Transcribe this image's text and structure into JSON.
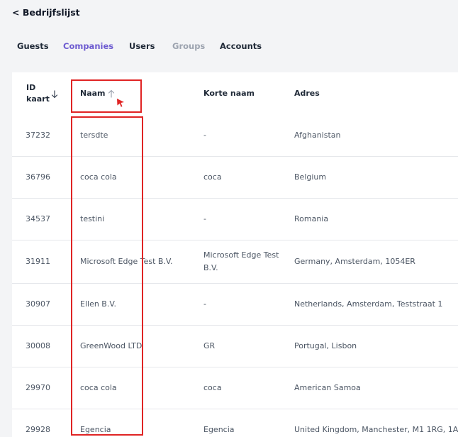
{
  "back_link": {
    "label": "< Bedrijfslijst"
  },
  "tabs": [
    {
      "label": "Guests",
      "state": "default"
    },
    {
      "label": "Companies",
      "state": "active"
    },
    {
      "label": "Users",
      "state": "default"
    },
    {
      "label": "Groups",
      "state": "disabled"
    },
    {
      "label": "Accounts",
      "state": "default"
    }
  ],
  "colors": {
    "active_tab": "#6d5bd0",
    "highlight": "#e02424",
    "cursor": "#e02424"
  },
  "table": {
    "headers": {
      "id_line1": "ID",
      "id_line2": "kaart",
      "naam": "Naam",
      "korte_naam": "Korte naam",
      "adres": "Adres"
    },
    "sort": {
      "id": "descending",
      "naam": "ascending"
    },
    "rows": [
      {
        "id": "37232",
        "naam": "tersdte",
        "korte_naam": "-",
        "adres": "Afghanistan"
      },
      {
        "id": "36796",
        "naam": "coca cola",
        "korte_naam": "coca",
        "adres": "Belgium"
      },
      {
        "id": "34537",
        "naam": "testini",
        "korte_naam": "-",
        "adres": "Romania"
      },
      {
        "id": "31911",
        "naam": "Microsoft Edge Test B.V.",
        "korte_naam": "Microsoft Edge Test B.V.",
        "adres": "Germany, Amsterdam, 1054ER"
      },
      {
        "id": "30907",
        "naam": "Ellen B.V.",
        "korte_naam": "-",
        "adres": "Netherlands, Amsterdam, Teststraat 1"
      },
      {
        "id": "30008",
        "naam": "GreenWood LTD",
        "korte_naam": "GR",
        "adres": "Portugal, Lisbon"
      },
      {
        "id": "29970",
        "naam": "coca cola",
        "korte_naam": "coca",
        "adres": "American Samoa"
      },
      {
        "id": "29928",
        "naam": "Egencia",
        "korte_naam": "Egencia",
        "adres": "United Kingdom, Manchester, M1 1RG, 1A"
      }
    ]
  }
}
